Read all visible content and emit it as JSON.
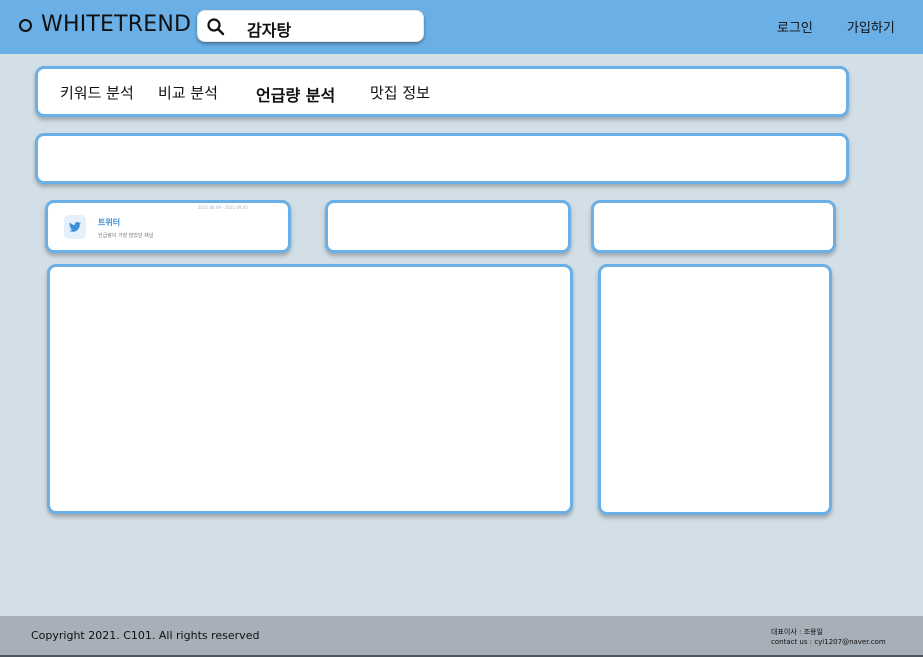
{
  "header": {
    "brand": "WHITETREND",
    "search_value": "감자탕",
    "login_label": "로그인",
    "signup_label": "가입하기"
  },
  "tabs": [
    {
      "label": "키워드 분석",
      "active": false
    },
    {
      "label": "비교 분석",
      "active": false
    },
    {
      "label": "언급량 분석",
      "active": true
    },
    {
      "label": "맛집 정보",
      "active": false
    }
  ],
  "channel_card": {
    "date_range": "2021.08.09 - 2021.09.05",
    "name": "트위터",
    "description": "언급량이 가장 많았던 채널",
    "icon": "twitter-icon"
  },
  "footer": {
    "copyright": "Copyright 2021. C101. All rights reserved",
    "ceo": "대표이사 : 조용일",
    "contact": "contact us : cyi1207@naver.com"
  },
  "colors": {
    "header_bg": "#6aafe6",
    "page_bg": "#d3dfe6",
    "card_border": "#6aafe6",
    "footer_bg": "#a7afb8",
    "accent_text": "#3e8fd8"
  }
}
